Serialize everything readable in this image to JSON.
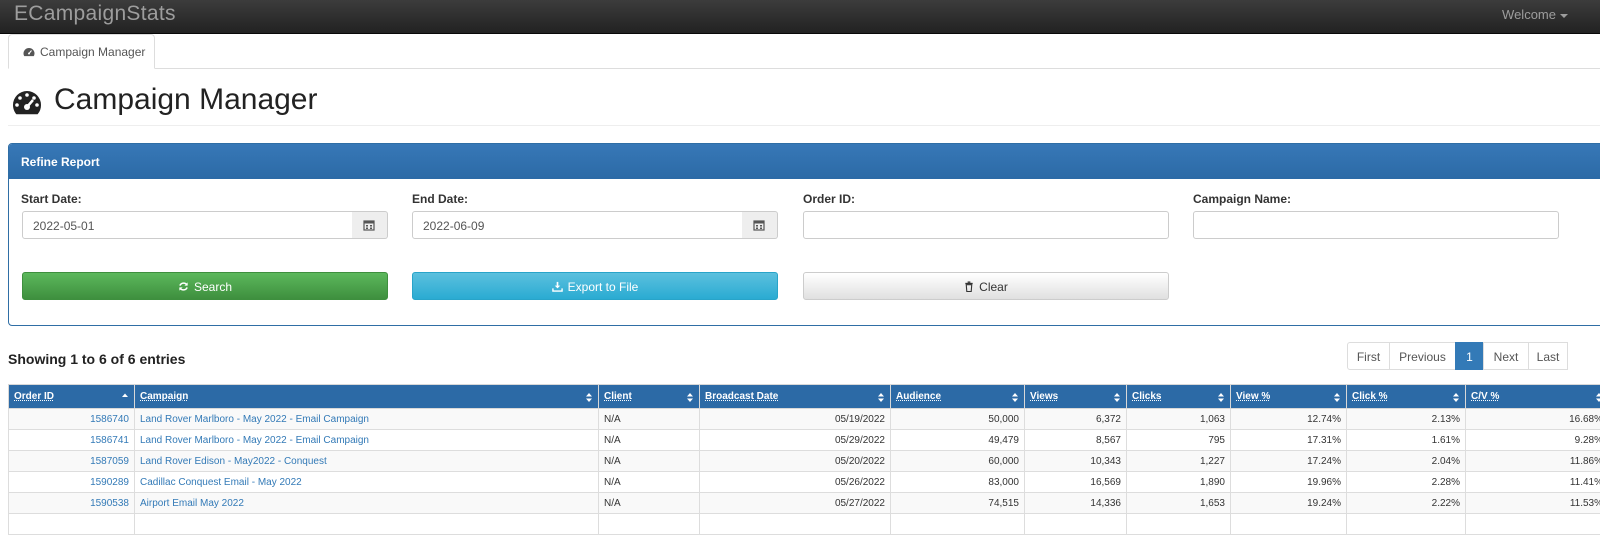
{
  "navbar": {
    "brand": "ECampaignStats",
    "welcome": "Welcome"
  },
  "tab": {
    "label": "Campaign Manager",
    "icon": "dashboard-icon"
  },
  "page": {
    "title": "Campaign Manager",
    "icon": "dashboard-icon"
  },
  "refine": {
    "heading": "Refine Report",
    "start_label": "Start Date:",
    "start_value": "2022-05-01",
    "end_label": "End Date:",
    "end_value": "2022-06-09",
    "order_label": "Order ID:",
    "order_value": "",
    "campaign_label": "Campaign Name:",
    "campaign_value": "",
    "search_label": "Search",
    "export_label": "Export to File",
    "clear_label": "Clear"
  },
  "entries": "Showing 1 to 6 of 6 entries",
  "pagination": {
    "first": "First",
    "previous": "Previous",
    "current": "1",
    "next": "Next",
    "last": "Last"
  },
  "table": {
    "headers": [
      "Order ID",
      "Campaign",
      "Client",
      "Broadcast Date",
      "Audience",
      "Views",
      "Clicks",
      "View %",
      "Click %",
      "C/V %"
    ],
    "rows": [
      [
        "1586740",
        "Land Rover Marlboro - May 2022 - Email Campaign",
        "N/A",
        "05/19/2022",
        "50,000",
        "6,372",
        "1,063",
        "12.74%",
        "2.13%",
        "16.68%"
      ],
      [
        "1586741",
        "Land Rover Marlboro - May 2022 - Email Campaign",
        "N/A",
        "05/29/2022",
        "49,479",
        "8,567",
        "795",
        "17.31%",
        "1.61%",
        "9.28%"
      ],
      [
        "1587059",
        "Land Rover Edison - May2022 - Conquest",
        "N/A",
        "05/20/2022",
        "60,000",
        "10,343",
        "1,227",
        "17.24%",
        "2.04%",
        "11.86%"
      ],
      [
        "1590289",
        "Cadillac Conquest Email - May 2022",
        "N/A",
        "05/26/2022",
        "83,000",
        "16,569",
        "1,890",
        "19.96%",
        "2.28%",
        "11.41%"
      ],
      [
        "1590538",
        "Airport Email May 2022",
        "N/A",
        "05/27/2022",
        "74,515",
        "14,336",
        "1,653",
        "19.24%",
        "2.22%",
        "11.53%"
      ]
    ]
  }
}
